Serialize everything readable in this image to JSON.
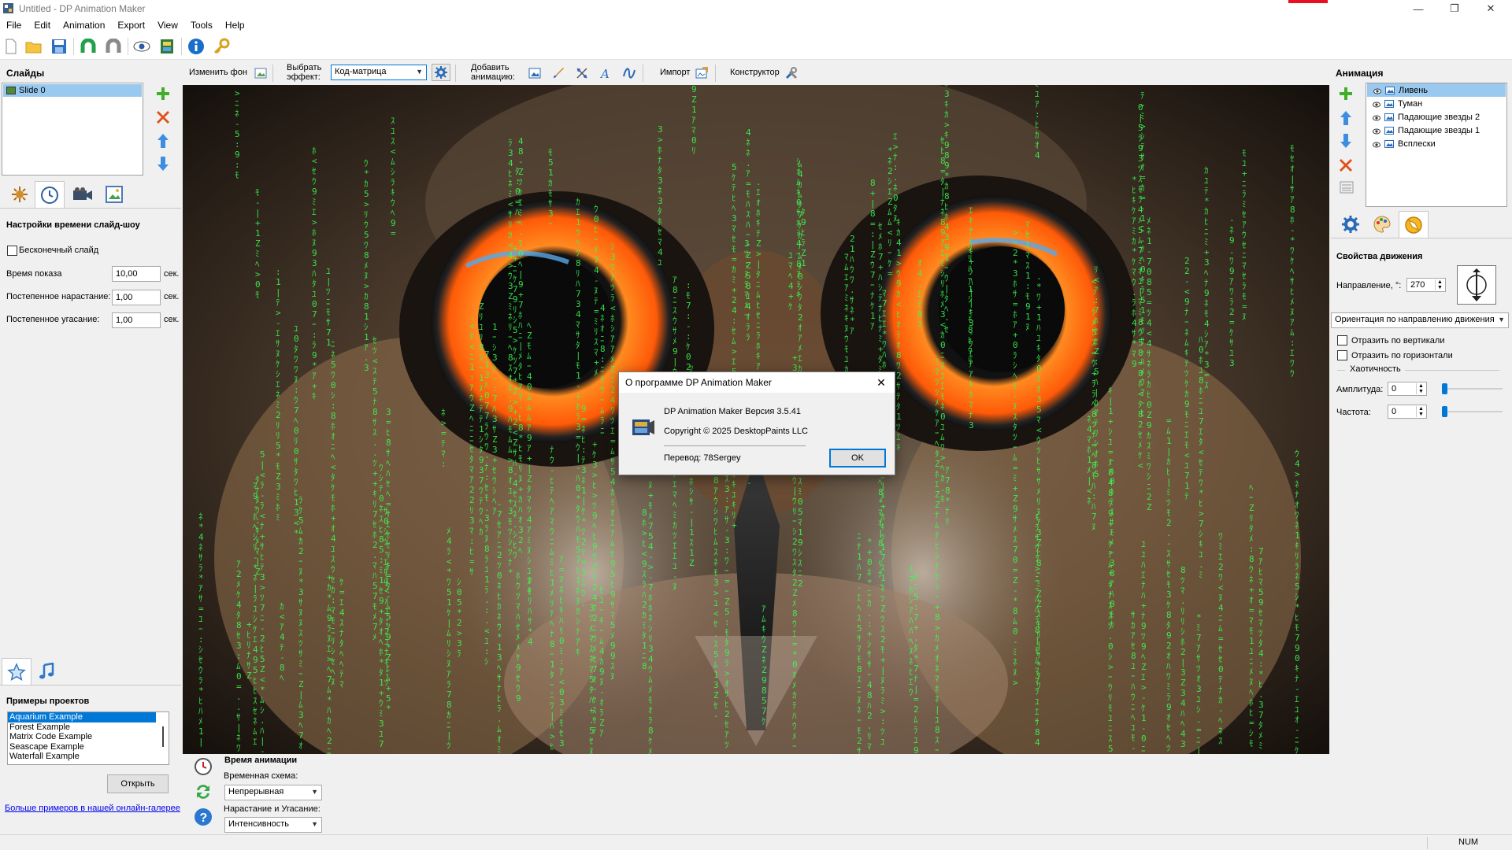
{
  "window": {
    "title": "Untitled - DP Animation Maker",
    "minimize_glyph": "—",
    "maximize_glyph": "❐",
    "close_glyph": "✕"
  },
  "menu": [
    "File",
    "Edit",
    "Animation",
    "Export",
    "View",
    "Tools",
    "Help"
  ],
  "toolbar": {
    "icons": [
      "new-icon",
      "open-folder-icon",
      "save-icon",
      "undo-magnet-icon",
      "redo-magnet-icon",
      "preview-eye-icon",
      "film-icon",
      "info-icon",
      "key-icon"
    ]
  },
  "effect_bar": {
    "change_bg_label": "Изменить фон",
    "choose_effect_label_1": "Выбрать",
    "choose_effect_label_2": "эффект:",
    "effect_value": "Код-матрица",
    "add_animation_label_1": "Добавить",
    "add_animation_label_2": "анимацию:",
    "import_label": "Импорт",
    "constructor_label": "Конструктор"
  },
  "slides_panel": {
    "title": "Слайды",
    "items": [
      "Slide 0"
    ]
  },
  "slide_settings": {
    "title": "Настройки времени слайд-шоу",
    "infinite_label": "Бесконечный слайд",
    "infinite_checked": false,
    "show_time_label": "Время показа",
    "show_time_value": "10,00",
    "fade_in_label": "Постепенное нарастание:",
    "fade_in_value": "1,00",
    "fade_out_label": "Постепенное угасание:",
    "fade_out_value": "1,00",
    "unit": "сек."
  },
  "examples_panel": {
    "title": "Примеры проектов",
    "items": [
      "Aquarium Example",
      "Forest Example",
      "Matrix Code Example",
      "Seascape Example",
      "Waterfall Example"
    ],
    "selected_index": 0,
    "open_button": "Открыть",
    "more_link": "Больше примеров в нашей онлайн-галерее"
  },
  "anim_timing": {
    "title": "Время анимации",
    "scheme_label": "Временная схема:",
    "scheme_value": "Непрерывная",
    "fade_label": "Нарастание и Угасание:",
    "fade_value": "Интенсивность"
  },
  "animation_panel": {
    "title": "Анимация",
    "items": [
      "Ливень",
      "Туман",
      "Падающие звезды 2",
      "Падающие звезды 1",
      "Всплески"
    ],
    "selected_index": 0
  },
  "motion_props": {
    "title": "Свойства движения",
    "direction_label": "Направление, °:",
    "direction_value": "270",
    "orientation_value": "Ориентация по направлению движения",
    "flip_vertical_label": "Отразить по вертикали",
    "flip_horizontal_label": "Отразить по горизонтали",
    "chaos_label": "Хаотичность",
    "amplitude_label": "Амплитуда:",
    "amplitude_value": "0",
    "frequency_label": "Частота:",
    "frequency_value": "0"
  },
  "about_dialog": {
    "title": "О программе DP Animation Maker",
    "version_line": "DP Animation Maker Версия 3.5.41",
    "copyright_line": "Copyright © 2025 DesktopPaints LLC",
    "translation_line": "Перевод: 78Sergey",
    "ok_button": "OK"
  },
  "status_bar": {
    "num": "NUM"
  },
  "colors": {
    "selection": "#99c9ef",
    "list_selection": "#0078d7",
    "link": "#0000ee",
    "matrix_green": "#39ff50",
    "owl_eye_orange": "#ff6a10"
  }
}
